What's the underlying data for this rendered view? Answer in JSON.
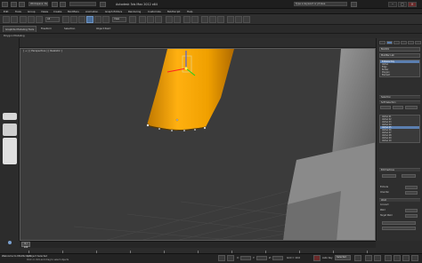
{
  "app": {
    "title": "Autodesk 3ds Max 2012 x64",
    "search_placeholder": "Type a keyword or phrase"
  },
  "menubar": {
    "items": [
      "Edit",
      "Tools",
      "Group",
      "Views",
      "Create",
      "Modifiers",
      "Animation",
      "Graph Editors",
      "Rendering",
      "Customize",
      "MAXScript",
      "Help"
    ]
  },
  "toolbar": {
    "undo_label": "undo",
    "workspace_value": "Workspace: Default",
    "filter_value": "All",
    "refcoord_value": "View"
  },
  "ribbon": {
    "tabs": [
      "Graphite Modeling Tools",
      "Freeform",
      "Selection",
      "Object Paint"
    ],
    "active_index": 0,
    "sublabel": "Polygon Modeling"
  },
  "viewport": {
    "label": "[ + ] [ Perspective ] [ Realistic ]"
  },
  "command_panel": {
    "object_name": "Box001",
    "modifier_list_label": "Modifier List",
    "stack": [
      "Editable Poly",
      "Vertex",
      "Edge",
      "Border",
      "Polygon",
      "Element"
    ],
    "stack_selected": 0,
    "sections": {
      "selection": "Selection",
      "soft_selection": "Soft Selection",
      "edit_vertices": "Edit Vertices",
      "weld": "Weld",
      "chamfer": "Chamfer",
      "target_weld": "Target Weld"
    },
    "list2": [
      "Vertex 01",
      "Vertex 02",
      "Vertex 03",
      "Vertex 04",
      "Vertex 05",
      "Vertex 06",
      "Vertex 07",
      "Vertex 08",
      "Vertex 09",
      "Vertex 10"
    ],
    "list2_selected": 4,
    "rows": [
      {
        "label": "Create Geometry"
      },
      {
        "label": "Remove"
      },
      {
        "label": "Break"
      },
      {
        "label": "Extrude"
      },
      {
        "label": "Chamfer"
      },
      {
        "label": "Connect"
      },
      {
        "label": "Weld"
      },
      {
        "label": "Target Weld"
      }
    ]
  },
  "timeline": {
    "current_frame": "0 / 100",
    "ticks": [
      "0",
      "10",
      "20",
      "30",
      "40",
      "50",
      "60",
      "70",
      "80",
      "90",
      "100"
    ]
  },
  "status": {
    "welcome": "Welcome to MAXScript.",
    "selection": "1 Object Selected",
    "prompt": "Click or click-and-drag to select objects",
    "x_label": "X:",
    "y_label": "Y:",
    "z_label": "Z:",
    "grid": "Grid = 10.0",
    "autokey_label": "Auto Key",
    "selected_value": "Selected",
    "setkey_label": "Set Key"
  }
}
